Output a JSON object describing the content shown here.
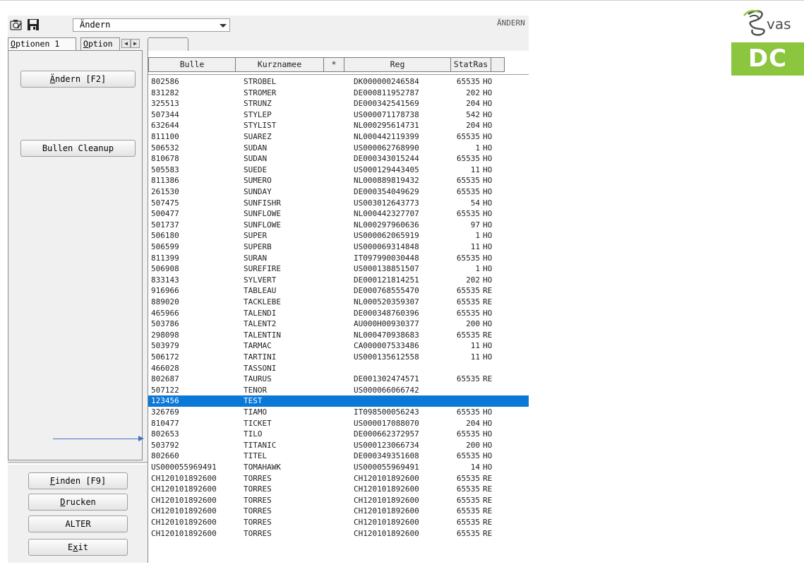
{
  "toolbar": {
    "mode_combo_value": "Ändern",
    "mode_label": "ÄNDERN",
    "icons": [
      "camera-icon",
      "save-disk-icon",
      "chevron-down-icon"
    ]
  },
  "tabs": [
    {
      "label": "Optionen 1",
      "mnemonic": "O"
    },
    {
      "label": "Option",
      "mnemonic": "O"
    }
  ],
  "buttons": {
    "aendern": {
      "mn": "Ä",
      "rest": "ndern [F2]"
    },
    "cleanup": "Bullen Cleanup",
    "finden": {
      "mn": "F",
      "rest": "inden [F9]"
    },
    "drucken": {
      "mn": "D",
      "rest": "rucken"
    },
    "alter": "ALTER",
    "exit": {
      "pre": "E",
      "mn": "x",
      "rest": "it"
    }
  },
  "table": {
    "columns": [
      "Bulle",
      "Kurznamee",
      "*",
      "Reg",
      "StatRas"
    ],
    "selected_row_index": 31,
    "rows": [
      [
        "802586",
        "STROBEL",
        "DK000000246584",
        "65535",
        "HO"
      ],
      [
        "831282",
        "STROMER",
        "DE000811952787",
        "202",
        "HO"
      ],
      [
        "325513",
        "STRUNZ",
        "DE000342541569",
        "204",
        "HO"
      ],
      [
        "507344",
        "STYLEP",
        "US000071178738",
        "542",
        "HO"
      ],
      [
        "632644",
        "STYLIST",
        "NL000295614731",
        "204",
        "HO"
      ],
      [
        "811100",
        "SUAREZ",
        "NL000442119399",
        "65535",
        "HO"
      ],
      [
        "506532",
        "SUDAN",
        "US000062768990",
        "1",
        "HO"
      ],
      [
        "810678",
        "SUDAN",
        "DE000343015244",
        "65535",
        "HO"
      ],
      [
        "505583",
        "SUEDE",
        "US000129443405",
        "11",
        "HO"
      ],
      [
        "811386",
        "SUMERO",
        "NL000889819432",
        "65535",
        "HO"
      ],
      [
        "261530",
        "SUNDAY",
        "DE000354049629",
        "65535",
        "HO"
      ],
      [
        "507475",
        "SUNFISHR",
        "US003012643773",
        "54",
        "HO"
      ],
      [
        "500477",
        "SUNFLOWE",
        "NL000442327707",
        "65535",
        "HO"
      ],
      [
        "501737",
        "SUNFLOWE",
        "NL000297960636",
        "97",
        "HO"
      ],
      [
        "506180",
        "SUPER",
        "US000062065919",
        "1",
        "HO"
      ],
      [
        "506599",
        "SUPERB",
        "US000069314848",
        "11",
        "HO"
      ],
      [
        "811399",
        "SURAN",
        "IT097990030448",
        "65535",
        "HO"
      ],
      [
        "506908",
        "SUREFIRE",
        "US000138851507",
        "1",
        "HO"
      ],
      [
        "833143",
        "SYLVERT",
        "DE000121814251",
        "202",
        "HO"
      ],
      [
        "916966",
        "TABLEAU",
        "DE000768555470",
        "65535",
        "RE"
      ],
      [
        "889020",
        "TACKLEBE",
        "NL000520359307",
        "65535",
        "RE"
      ],
      [
        "465966",
        "TALENDI",
        "DE000348760396",
        "65535",
        "HO"
      ],
      [
        "503786",
        "TALENT2",
        "AU000H00930377",
        "200",
        "HO"
      ],
      [
        "298098",
        "TALENTIN",
        "NL000470938683",
        "65535",
        "RE"
      ],
      [
        "503979",
        "TARMAC",
        "CA000007533486",
        "11",
        "HO"
      ],
      [
        "506172",
        "TARTINI",
        "US000135612558",
        "11",
        "HO"
      ],
      [
        "466028",
        "TASSONI",
        "",
        "",
        ""
      ],
      [
        "802687",
        "TAURUS",
        "DE001302474571",
        "65535",
        "RE"
      ],
      [
        "507122",
        "TENOR",
        "US000066066742",
        "",
        ""
      ],
      [
        "123456",
        "TEST",
        "",
        "",
        ""
      ],
      [
        "326769",
        "TIAMO",
        "IT098500056243",
        "65535",
        "HO"
      ],
      [
        "810477",
        "TICKET",
        "US000017088070",
        "204",
        "HO"
      ],
      [
        "802653",
        "TILO",
        "DE000662372957",
        "65535",
        "HO"
      ],
      [
        "503792",
        "TITANIC",
        "US000123066734",
        "200",
        "HO"
      ],
      [
        "802660",
        "TITEL",
        "DE000349351608",
        "65535",
        "HO"
      ],
      [
        "US000055969491",
        "TOMAHAWK",
        "US000055969491",
        "14",
        "HO"
      ],
      [
        "CH120101892600",
        "TORRES",
        "CH120101892600",
        "65535",
        "RE"
      ],
      [
        "CH120101892600",
        "TORRES",
        "CH120101892600",
        "65535",
        "RE"
      ],
      [
        "CH120101892600",
        "TORRES",
        "CH120101892600",
        "65535",
        "RE"
      ],
      [
        "CH120101892600",
        "TORRES",
        "CH120101892600",
        "65535",
        "RE"
      ],
      [
        "CH120101892600",
        "TORRES",
        "CH120101892600",
        "65535",
        "RE"
      ],
      [
        "CH120101892600",
        "TORRES",
        "CH120101892600",
        "65535",
        "RE"
      ]
    ]
  },
  "logo": {
    "vas": "vas",
    "dc": "DC"
  },
  "colors": {
    "selection": "#0a78d7",
    "logo_green": "#8cc63f",
    "arrow": "#4472c4"
  }
}
